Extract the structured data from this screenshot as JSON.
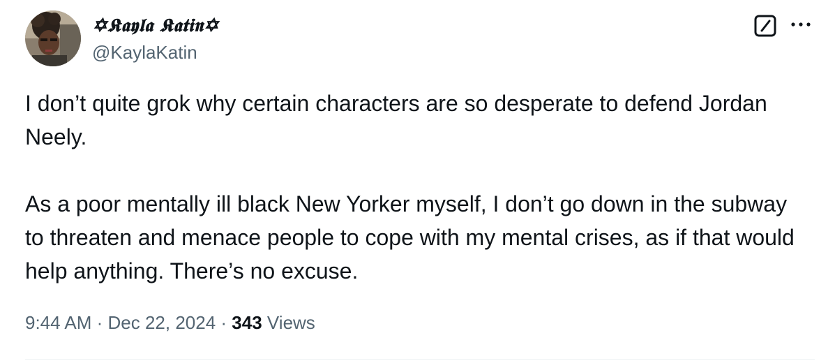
{
  "author": {
    "display_name": "✡𝕶𝖆𝖞𝖑𝖆 𝕶𝖆𝖙𝖎𝖓✡",
    "handle": "@KaylaKatin"
  },
  "icons": {
    "grok": "grok-icon",
    "more": "more-icon",
    "avatar": "avatar"
  },
  "tweet": {
    "paragraphs": [
      "I don’t quite grok why certain characters are so desperate to defend Jordan Neely.",
      "As a poor mentally ill black New Yorker myself, I don’t go down in the subway to threaten and menace people to cope with my mental crises, as if that would help anything. There’s no excuse."
    ]
  },
  "meta": {
    "time": "9:44 AM",
    "separator": " · ",
    "date": "Dec 22, 2024",
    "views_count": "343",
    "views_label": "Views"
  },
  "colors": {
    "text": "#0f1419",
    "secondary": "#536471",
    "divider": "#eff3f4"
  }
}
